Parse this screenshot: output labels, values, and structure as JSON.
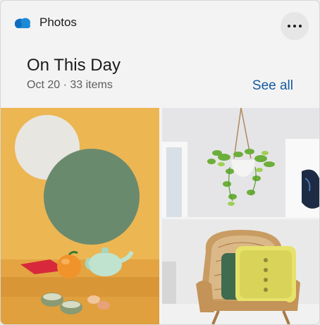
{
  "header": {
    "app_name": "Photos",
    "app_icon": "onedrive-cloud-icon",
    "more_icon": "more-horizontal-icon"
  },
  "memory": {
    "title": "On This Day",
    "subtitle": "Oct 20 · 33 items",
    "see_all_label": "See all"
  },
  "colors": {
    "accent": "#155aa0",
    "cloud_blue": "#0f6cbd",
    "card_background": "#f3f3f3"
  }
}
